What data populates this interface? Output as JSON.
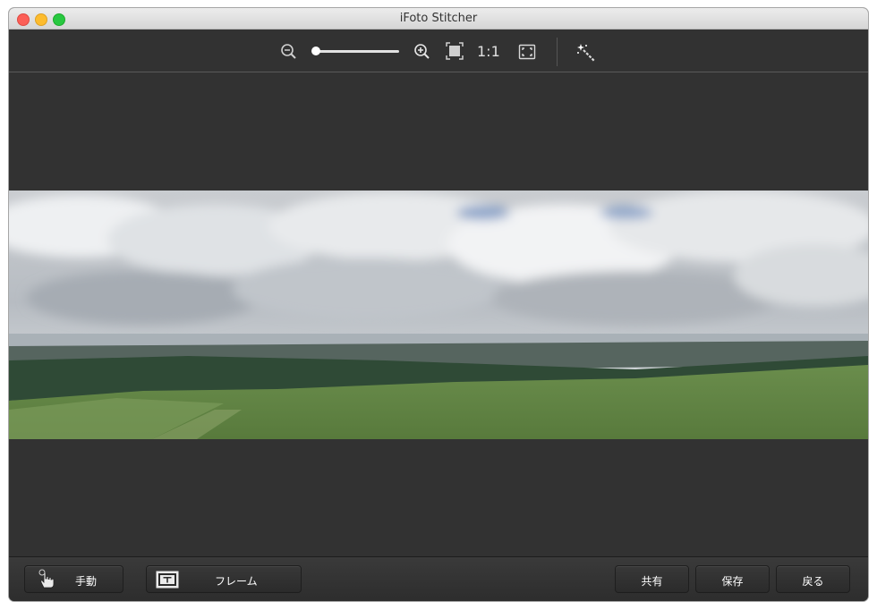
{
  "window": {
    "title": "iFoto Stitcher"
  },
  "toolbar": {
    "zoom_out_icon": "zoom-out-icon",
    "zoom_slider_value": 0.0,
    "zoom_in_icon": "zoom-in-icon",
    "fit_icon": "fit-to-window-icon",
    "actual_size_label": "1:1",
    "fullscreen_icon": "fullscreen-icon",
    "magic_wand_icon": "magic-wand-icon"
  },
  "canvas": {
    "image": "stitched-panorama-landscape"
  },
  "bottom": {
    "manual_label": "手動",
    "frame_label": "フレーム",
    "share_label": "共有",
    "save_label": "保存",
    "back_label": "戻る"
  },
  "colors": {
    "background": "#323232",
    "toolbar_icon": "#d8d8d8",
    "button_text": "#ffffff",
    "close": "#fc5f57",
    "minimize": "#fdbc2e",
    "maximize": "#28c840"
  }
}
